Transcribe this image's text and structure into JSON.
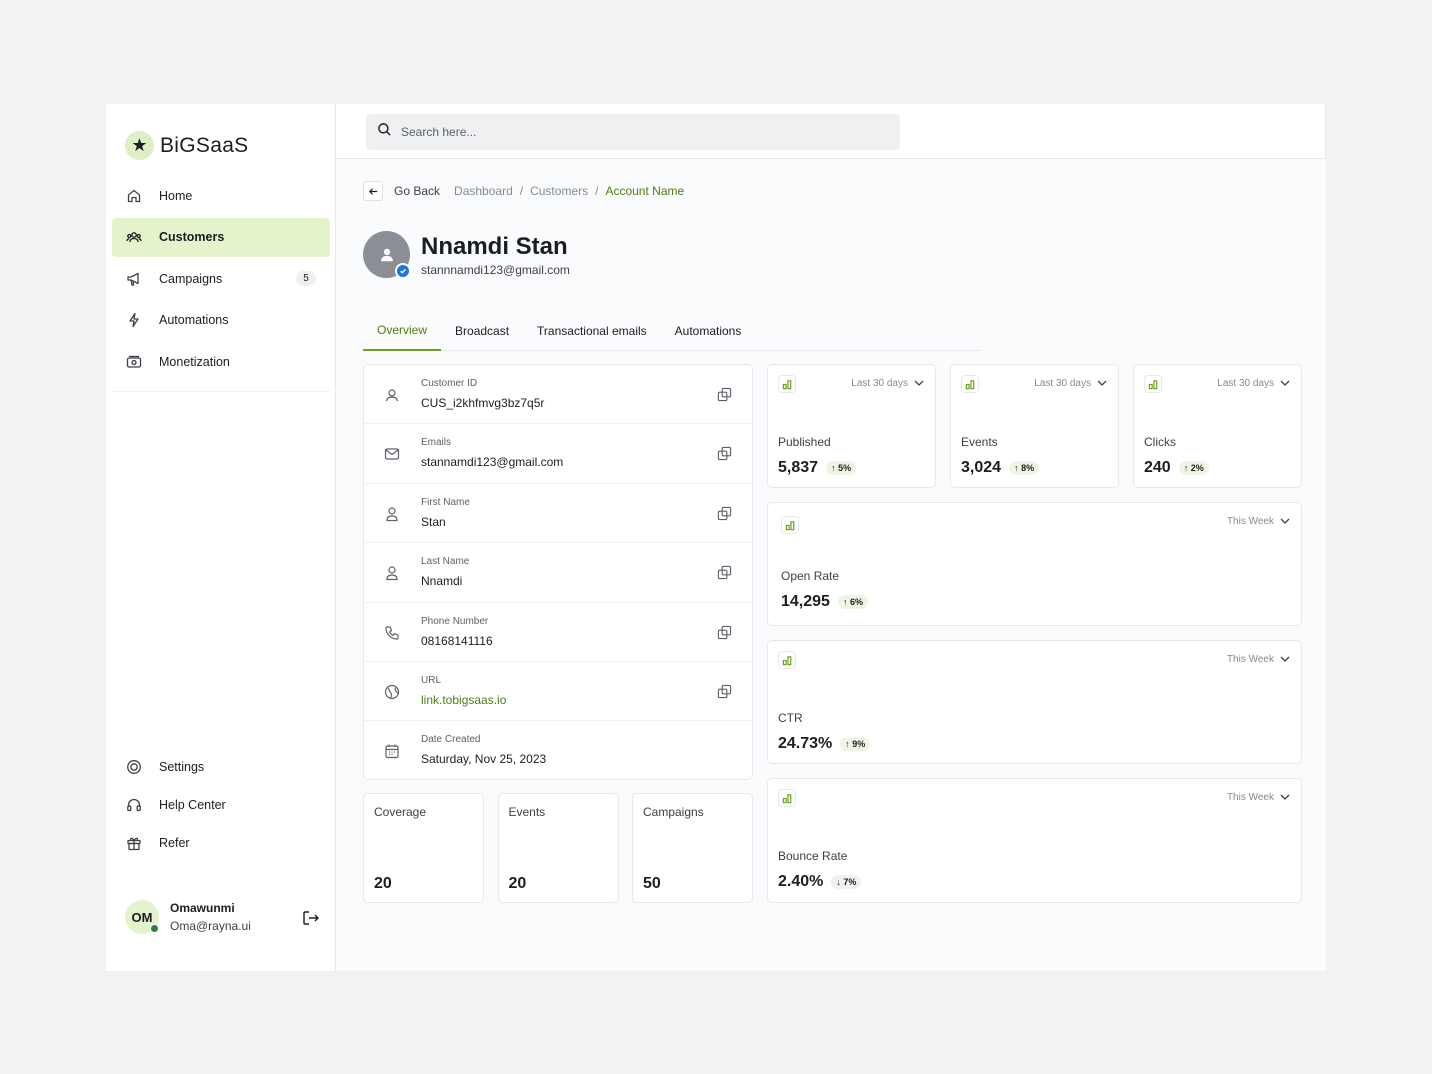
{
  "brand": {
    "logo_icon": "star-icon",
    "name": "BiGSaaS"
  },
  "sidebar": {
    "nav": [
      {
        "label": "Home",
        "icon": "home-icon"
      },
      {
        "label": "Customers",
        "icon": "users-icon",
        "active": true
      },
      {
        "label": "Campaigns",
        "icon": "megaphone-icon",
        "badge": "5"
      },
      {
        "label": "Automations",
        "icon": "bolt-icon"
      },
      {
        "label": "Monetization",
        "icon": "money-icon"
      }
    ],
    "bottom": [
      {
        "label": "Settings",
        "icon": "settings-icon"
      },
      {
        "label": "Help Center",
        "icon": "headset-icon"
      },
      {
        "label": "Refer",
        "icon": "gift-icon"
      }
    ],
    "user": {
      "initials": "OM",
      "name": "Omawunmi",
      "email": "Oma@rayna.ui",
      "status_color": "#27813b"
    }
  },
  "search": {
    "placeholder": "Search here..."
  },
  "breadcrumb": {
    "back_label": "Go Back",
    "items": [
      "Dashboard",
      "Customers"
    ],
    "current": "Account Name"
  },
  "profile": {
    "name": "Nnamdi Stan",
    "email": "stannnamdi123@gmail.com",
    "verified": true
  },
  "tabs": [
    "Overview",
    "Broadcast",
    "Transactional emails",
    "Automations"
  ],
  "details": [
    {
      "label": "Customer ID",
      "value": "CUS_i2khfmvg3bz7q5r",
      "icon": "user-id-icon",
      "copy": true
    },
    {
      "label": "Emails",
      "value": "stannamdi123@gmail.com",
      "icon": "mail-icon",
      "copy": true
    },
    {
      "label": "First Name",
      "value": "Stan",
      "icon": "person-icon",
      "copy": true
    },
    {
      "label": "Last Name",
      "value": "Nnamdi",
      "icon": "person-icon",
      "copy": true
    },
    {
      "label": "Phone Number",
      "value": "08168141116",
      "icon": "phone-icon",
      "copy": true
    },
    {
      "label": "URL",
      "value": "link.tobigsaas.io",
      "icon": "globe-icon",
      "copy": true
    },
    {
      "label": "Date Created",
      "value": "Saturday, Nov 25, 2023",
      "icon": "calendar-icon",
      "copy": false
    }
  ],
  "mini_stats": [
    {
      "label": "Coverage",
      "value": "20"
    },
    {
      "label": "Events",
      "value": "20"
    },
    {
      "label": "Campaigns",
      "value": "50"
    }
  ],
  "metrics": {
    "published": {
      "period": "Last 30 days",
      "label": "Published",
      "value": "5,837",
      "trend": "5%",
      "trend_dir": "up"
    },
    "events": {
      "period": "Last 30 days",
      "label": "Events",
      "value": "3,024",
      "trend": "8%",
      "trend_dir": "up"
    },
    "clicks": {
      "period": "Last 30 days",
      "label": "Clicks",
      "value": "240",
      "trend": "2%",
      "trend_dir": "up"
    },
    "open_rate": {
      "period": "This Week",
      "label": "Open Rate",
      "value": "14,295",
      "trend": "6%",
      "trend_dir": "up"
    },
    "ctr": {
      "period": "This Week",
      "label": "CTR",
      "value": "24.73%",
      "trend": "9%",
      "trend_dir": "up"
    },
    "bounce_rate": {
      "period": "This Week",
      "label": "Bounce Rate",
      "value": "2.40%",
      "trend": "7%",
      "trend_dir": "down"
    }
  },
  "colors": {
    "accent": "#6b9f1f",
    "accent_text": "#4e7d10",
    "active_bg": "#e3f3cc",
    "verified": "#1d74e8"
  }
}
